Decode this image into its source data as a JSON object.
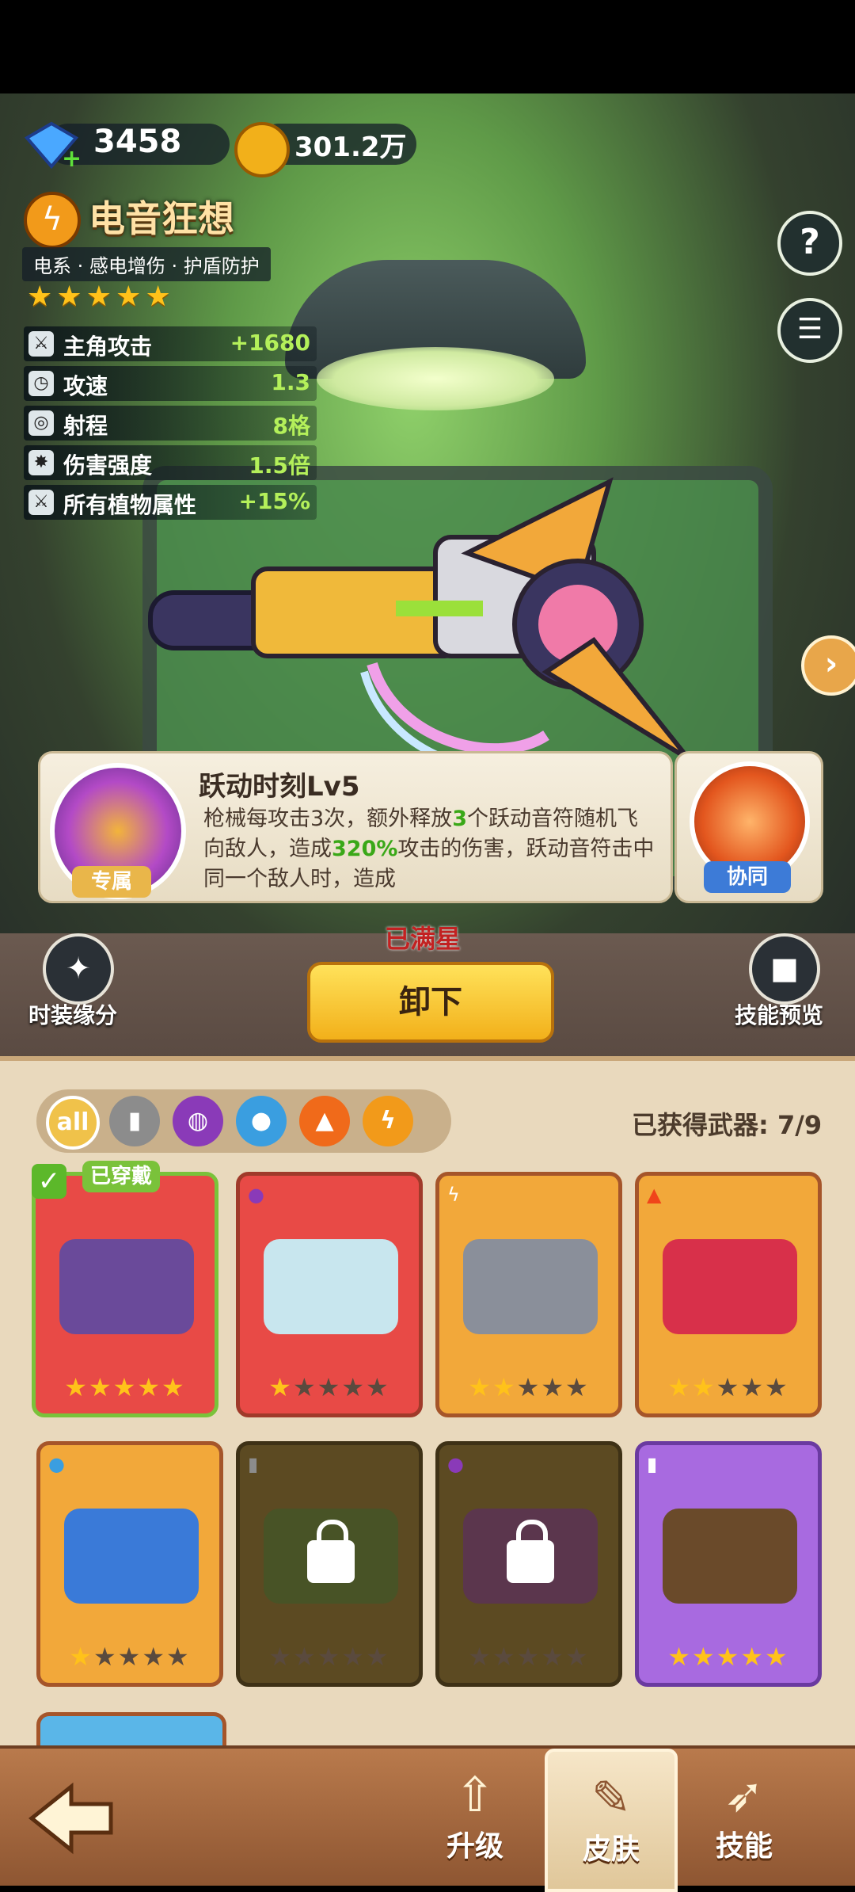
{
  "currency": {
    "gems_icon": "diamond-icon",
    "gems": "3458",
    "coins_icon": "coin-icon",
    "coins": "301.2万"
  },
  "weapon": {
    "element_icon": "lightning-icon",
    "name": "电音狂想",
    "tags": "电系 · 感电增伤 · 护盾防护",
    "stars": 5
  },
  "stats": [
    {
      "icon": "attack-icon",
      "label": "主角攻击",
      "value": "+1680"
    },
    {
      "icon": "clock-icon",
      "label": "攻速",
      "value": "1.3"
    },
    {
      "icon": "target-icon",
      "label": "射程",
      "value": "8格"
    },
    {
      "icon": "damage-icon",
      "label": "伤害强度",
      "value": "1.5倍"
    },
    {
      "icon": "plant-attack-icon",
      "label": "所有植物属性",
      "value": "+15%"
    }
  ],
  "skill": {
    "title": "跃动时刻Lv5",
    "desc_parts": [
      "枪械每攻击3次，额外释放",
      "3",
      "个跃动音符随机飞向敌人，造成",
      "320%",
      "攻击的伤害，跃动音符击中同一个敌人时，造成"
    ],
    "exclusive_label": "专属",
    "sync_label": "协同"
  },
  "max_star_label": "已满星",
  "unequip_label": "卸下",
  "left_button_label": "时装缘分",
  "right_button_label": "技能预览",
  "filters": [
    "all",
    "knife-icon",
    "potion-icon",
    "water-icon",
    "fire-icon",
    "lightning-icon"
  ],
  "obtained_label": "已获得武器: 7/9",
  "equipped_label": "已穿戴",
  "cards": [
    {
      "bg": "#e84a46",
      "border": "#7ac23a",
      "stars": 5,
      "locked": false,
      "element": "",
      "equipped": true
    },
    {
      "bg": "#e84a46",
      "border": "#a03a2a",
      "stars": 1,
      "locked": false,
      "element": "potion-icon",
      "equipped": false
    },
    {
      "bg": "#f2a83a",
      "border": "#a5552a",
      "stars": 2,
      "locked": false,
      "element": "lightning-icon",
      "equipped": false
    },
    {
      "bg": "#f2a83a",
      "border": "#a5552a",
      "stars": 2,
      "locked": false,
      "element": "fire-icon",
      "equipped": false
    },
    {
      "bg": "#f2a83a",
      "border": "#a5552a",
      "stars": 1,
      "locked": false,
      "element": "water-icon",
      "equipped": false
    },
    {
      "bg": "#5c4a22",
      "border": "#3e3116",
      "stars": 0,
      "locked": true,
      "element": "knife-icon",
      "equipped": false
    },
    {
      "bg": "#5c4a22",
      "border": "#3e3116",
      "stars": 0,
      "locked": true,
      "element": "potion-icon",
      "equipped": false
    },
    {
      "bg": "#a86ae0",
      "border": "#6a3aa0",
      "stars": 5,
      "locked": false,
      "element": "knife-icon",
      "equipped": false
    }
  ],
  "tabs": [
    {
      "icon": "back-arrow-icon",
      "label": ""
    },
    {
      "icon": "upgrade-icon",
      "label": "升级"
    },
    {
      "icon": "skin-icon",
      "label": "皮肤"
    },
    {
      "icon": "skill-icon",
      "label": "技能"
    }
  ]
}
